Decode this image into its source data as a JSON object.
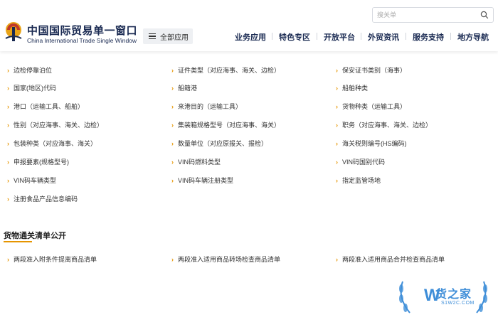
{
  "header": {
    "brand_cn": "中国国际贸易单一窗口",
    "brand_en": "China International Trade Single Window",
    "all_apps_label": "全部应用",
    "search_placeholder": "搜关单",
    "nav": [
      "业务应用",
      "特色专区",
      "开放平台",
      "外贸资讯",
      "服务支持",
      "地方导航"
    ]
  },
  "codes": {
    "col1": [
      "边检停靠泊位",
      "国家(地区)代码",
      "港口（运输工具、船舶）",
      "性别（对应海事、海关、边检）",
      "包装种类（对应海事、海关）",
      "申报要素(规格型号)",
      "VIN码车辆类型",
      "注册食品产品信息编码"
    ],
    "col2": [
      "证件类型（对应海事、海关、边检）",
      "船籍港",
      "来港目的（运输工具）",
      "集装箱规格型号（对应海事、海关）",
      "数量单位（对应原报关、报检）",
      "VIN码燃料类型",
      "VIN码车辆注册类型"
    ],
    "col3": [
      "保安证书类别（海事）",
      "船舶种类",
      "货物种类（运输工具）",
      "职务（对应海事、海关、边检）",
      "海关税则编号(HS编码)",
      "VIN码国别代码",
      "指定监管场地"
    ]
  },
  "section": {
    "title": "货物通关清单公开",
    "items": [
      "两段准入附条件提离商品清单",
      "两段准入适用商品转场检查商品清单",
      "两段准入适用商品合并检查商品清单"
    ]
  },
  "watermark": {
    "text": "货之家",
    "sub": "S1W2C.COM"
  },
  "colors": {
    "accent": "#e69500",
    "brand": "#1a2a52",
    "watermark": "#3f8ed8"
  }
}
